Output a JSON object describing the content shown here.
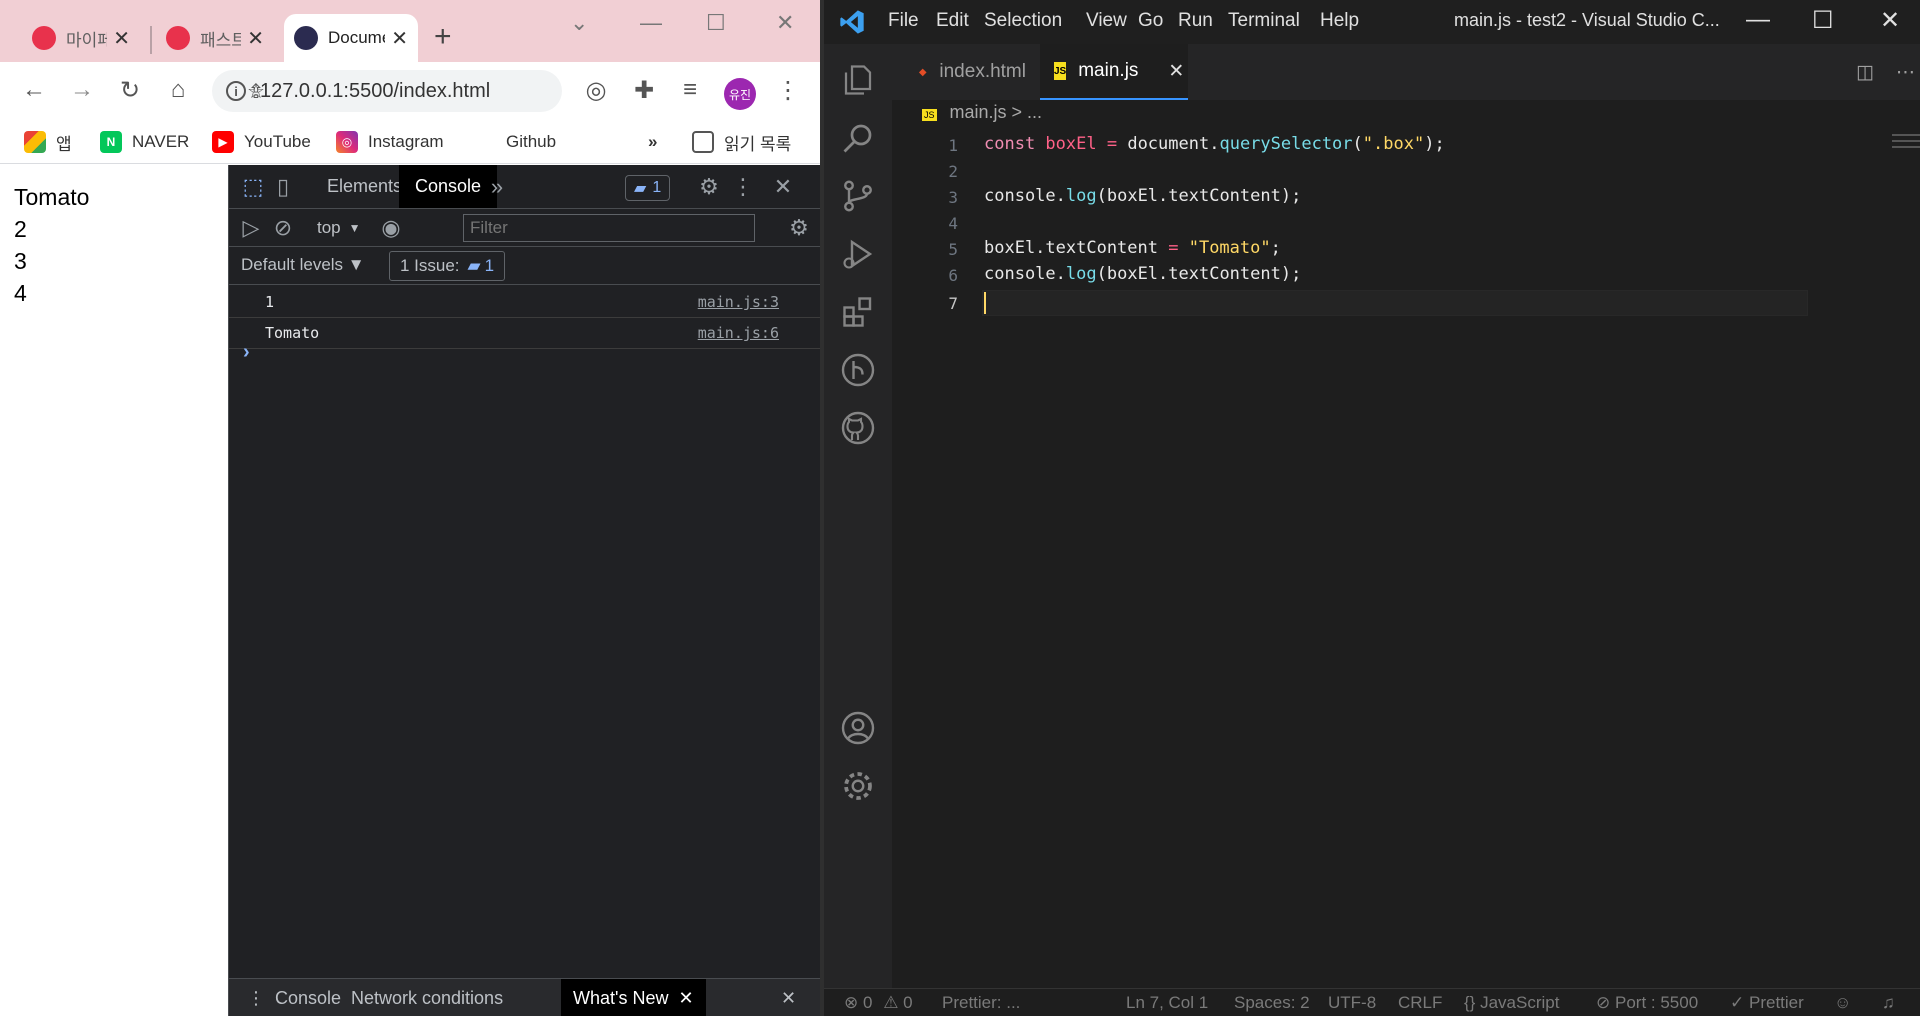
{
  "chrome": {
    "tabs": [
      {
        "title": "마이페",
        "favicon_color": "#e8324c"
      },
      {
        "title": "패스트",
        "favicon_color": "#e8324c"
      },
      {
        "title": "Document",
        "favicon_color": "#2b2b50"
      }
    ],
    "close_glyph": "✕",
    "new_tab_glyph": "+",
    "url": "127.0.0.1:5500/index.html",
    "profile_initials": "유진",
    "bookmarks": [
      {
        "label": "앱",
        "icon": "apps-grid-icon"
      },
      {
        "label": "NAVER",
        "icon": "naver-icon",
        "color": "#03c75a"
      },
      {
        "label": "YouTube",
        "icon": "youtube-icon",
        "color": "#ff0000"
      },
      {
        "label": "Instagram",
        "icon": "instagram-icon",
        "color": "#d6249f"
      },
      {
        "label": "Github",
        "icon": "github-icon"
      }
    ],
    "bookmarks_more": "»",
    "reading_list": "읽기 목록",
    "page_lines": [
      "Tomato",
      "2",
      "3",
      "4"
    ]
  },
  "devtools": {
    "tabs": [
      "Elements",
      "Console"
    ],
    "active_tab": "Console",
    "messages_badge": "1",
    "context": "top",
    "filter_placeholder": "Filter",
    "levels": "Default levels ▼",
    "issues_label": "1 Issue:",
    "issues_count": "1",
    "console_rows": [
      {
        "message": "1",
        "source": "main.js:3"
      },
      {
        "message": "Tomato",
        "source": "main.js:6"
      }
    ],
    "prompt": "›",
    "drawer_tabs": [
      "Console",
      "Network conditions",
      "What's New"
    ]
  },
  "vscode": {
    "menu": [
      "File",
      "Edit",
      "Selection",
      "View",
      "Go",
      "Run",
      "Terminal",
      "Help"
    ],
    "window_title": "main.js - test2 - Visual Studio C...",
    "editor_tabs": [
      {
        "label": "index.html",
        "icon": "html-file-icon"
      },
      {
        "label": "main.js",
        "icon": "js-file-icon"
      }
    ],
    "active_editor_tab": "main.js",
    "breadcrumb": "main.js  >  ...",
    "line_numbers": [
      "1",
      "2",
      "3",
      "4",
      "5",
      "6",
      "7"
    ],
    "code": {
      "line1": {
        "kw": "const ",
        "var": "boxEl",
        "op": " = ",
        "obj": "document",
        "dot": ".",
        "fn": "querySelector",
        "open": "(",
        "str": "\".box\"",
        "close": ");"
      },
      "line3": {
        "obj": "console",
        "dot": ".",
        "fn": "log",
        "rest": "(boxEl.textContent);"
      },
      "line5": {
        "lhs": "boxEl.textContent",
        "op": " = ",
        "str": "\"Tomato\"",
        "end": ";"
      },
      "line6": {
        "obj": "console",
        "dot": ".",
        "fn": "log",
        "rest": "(boxEl.textContent);"
      }
    },
    "status": {
      "errors": "0",
      "warnings": "0",
      "prettier_left": "Prettier: ...",
      "position": "Ln 7, Col 1",
      "spaces": "Spaces: 2",
      "encoding": "UTF-8",
      "eol": "CRLF",
      "language": "JavaScript",
      "port": "Port : 5500",
      "prettier_right": "Prettier"
    }
  }
}
